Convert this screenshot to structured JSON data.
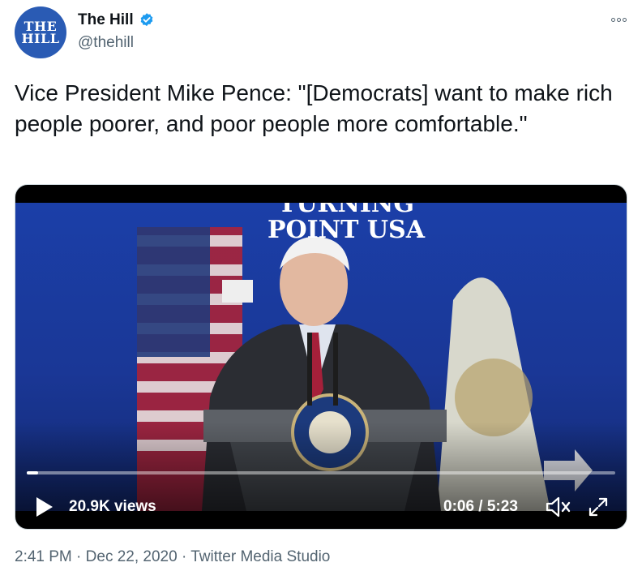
{
  "author": {
    "avatar_text_line1": "THE",
    "avatar_text_line2": "HILL",
    "display_name": "The Hill",
    "handle": "@thehill",
    "verified": true
  },
  "tweet": {
    "text": "Vice President Mike Pence: \"[Democrats] want to make rich people poorer, and poor people more comfortable.\""
  },
  "video": {
    "backdrop_sign_line1": "TURNING",
    "backdrop_sign_line2": "POINT USA",
    "views": "20.9K views",
    "time": "0:06 / 5:23",
    "progress": 0.0189
  },
  "meta": {
    "time": "2:41 PM",
    "separator": "·",
    "date": "Dec 22, 2020",
    "source": "Twitter Media Studio"
  },
  "colors": {
    "brand_blue": "#2a5bb4",
    "verified_blue": "#1d9bf0",
    "text_primary": "#0f1419",
    "text_secondary": "#536471"
  }
}
